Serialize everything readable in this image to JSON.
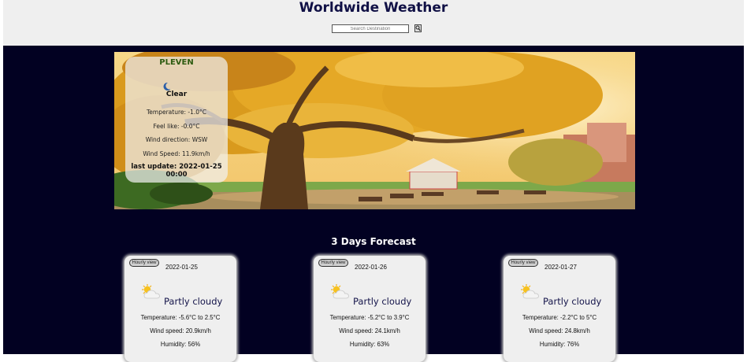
{
  "header": {
    "title": "Worldwide Weather"
  },
  "search": {
    "placeholder": "Search Destination"
  },
  "current": {
    "city": "PLEVEN",
    "condition": "Clear",
    "temperature": "Temperature:  -1.0°C",
    "feels_like": "Feel like:  -0.0°C",
    "wind_direction": "Wind direction: WSW",
    "wind_speed": "Wind Speed: 11.9km/h",
    "last_update": "last update: 2022-01-25 00:00"
  },
  "forecast": {
    "title": "3 Days Forecast",
    "days": [
      {
        "button": "Hourly view",
        "date": "2022-01-25",
        "condition": "Partly cloudy",
        "temperature": "Temperature: -5.6°C to 2.5°C",
        "wind": "Wind speed: 20.9km/h",
        "humidity": "Humidity: 56%"
      },
      {
        "button": "Hourly view",
        "date": "2022-01-26",
        "condition": "Partly cloudy",
        "temperature": "Temperature: -5.2°C to 3.9°C",
        "wind": "Wind speed: 24.1km/h",
        "humidity": "Humidity: 63%"
      },
      {
        "button": "Hourly view",
        "date": "2022-01-27",
        "condition": "Partly cloudy",
        "temperature": "Temperature: -2.2°C to 5°C",
        "wind": "Wind speed: 24.8km/h",
        "humidity": "Humidity: 76%"
      }
    ]
  },
  "icons": {
    "search": "magnifier-icon",
    "current_condition": "crescent-moon-icon",
    "forecast_condition": "partly-cloudy-icon"
  },
  "colors": {
    "page_background": "#020122",
    "header_background": "#efefef",
    "title": "#101045",
    "city": "#2d5b10"
  }
}
